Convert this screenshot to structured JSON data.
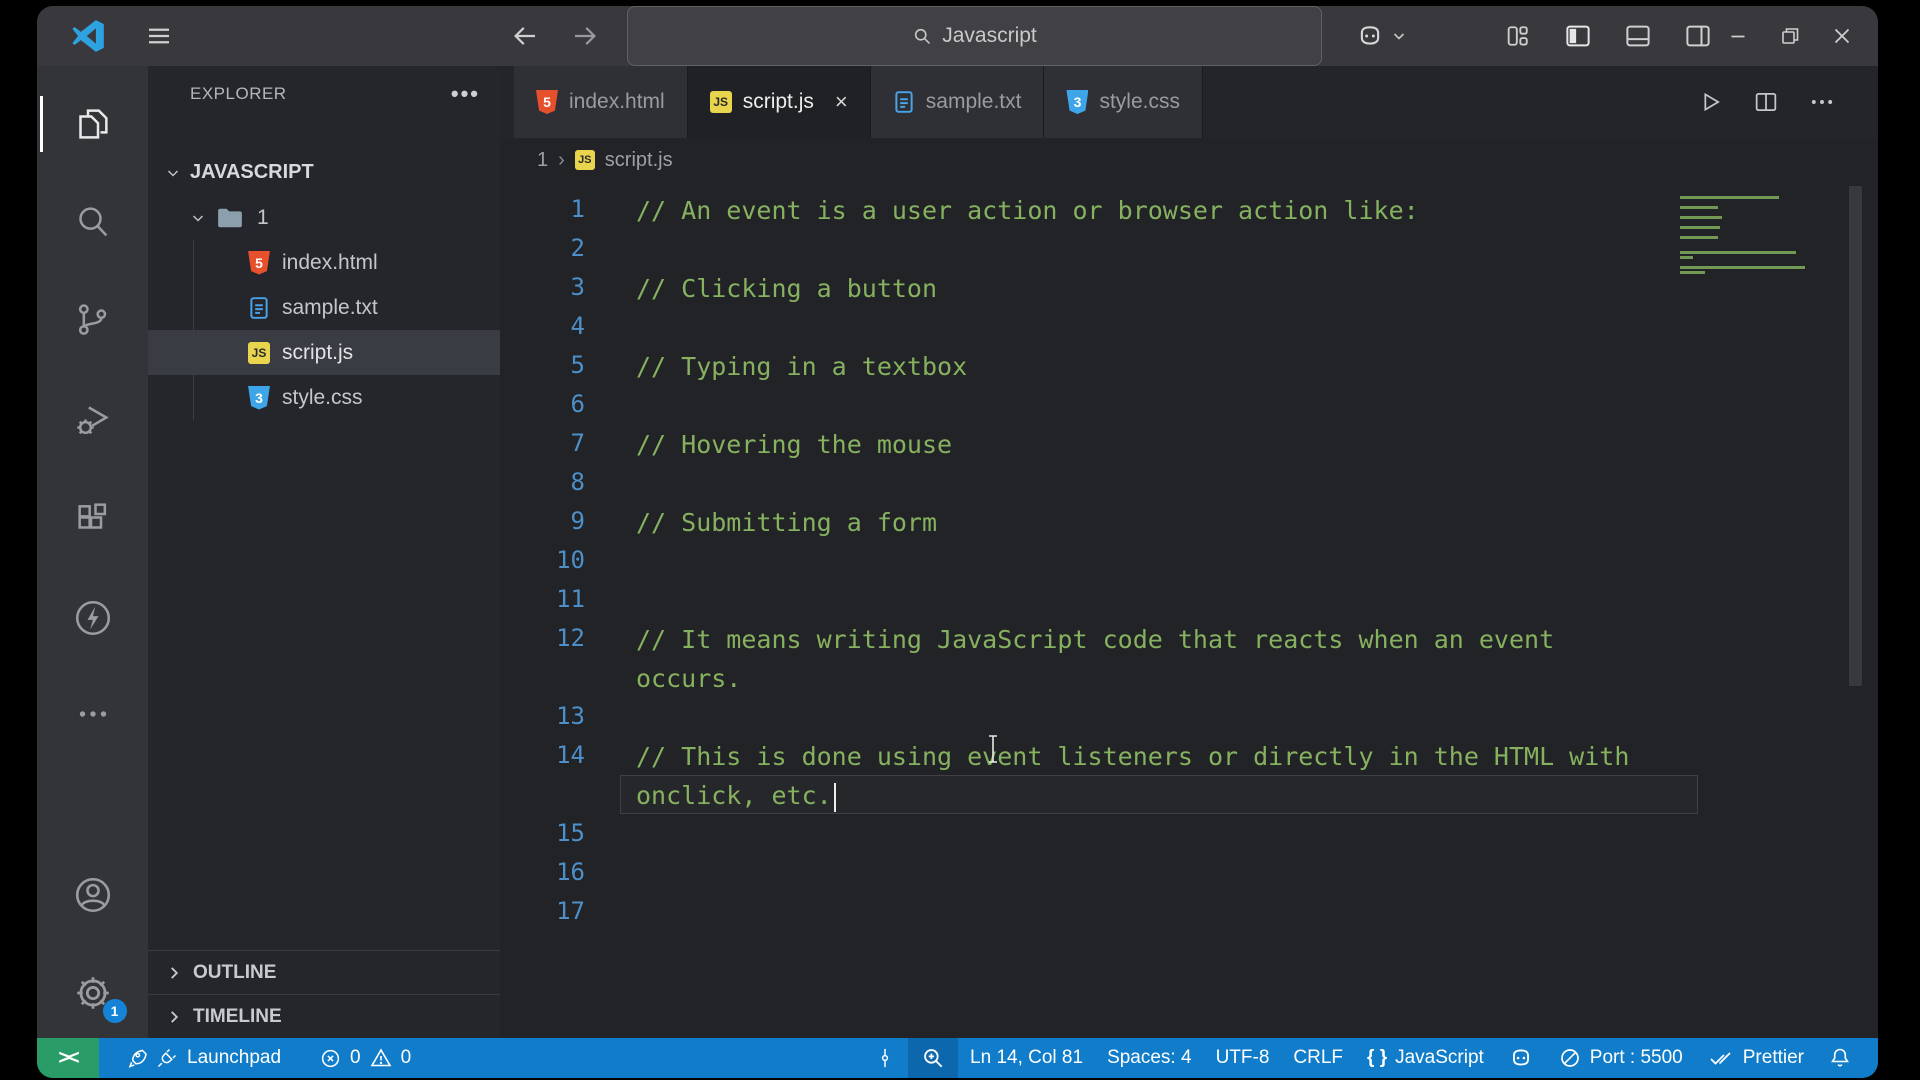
{
  "colors": {
    "statusbar_blue": "#117dca",
    "remote_green": "#2a9c68",
    "comment_green": "#86b15f",
    "line_number_blue": "#4d8fc9",
    "selection_gray": "#3a3c43",
    "badge_blue": "#1584d8",
    "html_icon_orange": "#e6502c",
    "css_icon_blue": "#3ea6e8",
    "js_icon_yellow": "#e8d44d"
  },
  "title_bar": {
    "search_value": "Javascript",
    "icons": [
      "vscode-logo",
      "menu",
      "arrow-left",
      "arrow-right",
      "search",
      "copilot",
      "chevron-down",
      "customize-layout",
      "toggle-sidebar-left",
      "toggle-panel",
      "toggle-sidebar-right",
      "minimize",
      "restore",
      "close"
    ]
  },
  "activity_bar": {
    "items": [
      {
        "name": "explorer",
        "icon": "files-icon",
        "active": true
      },
      {
        "name": "search",
        "icon": "search-icon"
      },
      {
        "name": "source-control",
        "icon": "git-icon"
      },
      {
        "name": "run-debug",
        "icon": "debug-icon"
      },
      {
        "name": "extensions",
        "icon": "extensions-icon"
      },
      {
        "name": "live-server",
        "icon": "lightning-icon"
      },
      {
        "name": "more",
        "icon": "ellipsis-icon"
      }
    ],
    "bottom": [
      {
        "name": "accounts",
        "icon": "account-icon"
      },
      {
        "name": "settings",
        "icon": "gear-icon",
        "badge": "1"
      }
    ]
  },
  "explorer": {
    "title": "EXPLORER",
    "more_label": "•••",
    "workspace": "JAVASCRIPT",
    "folder": "1",
    "files": [
      {
        "name": "index.html",
        "type": "html"
      },
      {
        "name": "sample.txt",
        "type": "txt"
      },
      {
        "name": "script.js",
        "type": "js",
        "selected": true
      },
      {
        "name": "style.css",
        "type": "css"
      }
    ],
    "sections": [
      "OUTLINE",
      "TIMELINE"
    ]
  },
  "tabs": [
    {
      "label": "index.html",
      "type": "html",
      "active": false
    },
    {
      "label": "script.js",
      "type": "js",
      "active": true,
      "close_glyph": "×"
    },
    {
      "label": "sample.txt",
      "type": "txt",
      "active": false
    },
    {
      "label": "style.css",
      "type": "css",
      "active": false
    }
  ],
  "editor_actions": [
    "run-icon",
    "split-editor-icon",
    "more-actions-icon"
  ],
  "breadcrumb": {
    "folder": "1",
    "separator": "›",
    "file": "script.js"
  },
  "editor": {
    "rows": [
      {
        "n": "1",
        "t": "// An event is a user action or browser action like:"
      },
      {
        "n": "2",
        "t": ""
      },
      {
        "n": "3",
        "t": "// Clicking a button"
      },
      {
        "n": "4",
        "t": ""
      },
      {
        "n": "5",
        "t": "// Typing in a textbox"
      },
      {
        "n": "6",
        "t": ""
      },
      {
        "n": "7",
        "t": "// Hovering the mouse"
      },
      {
        "n": "8",
        "t": ""
      },
      {
        "n": "9",
        "t": "// Submitting a form"
      },
      {
        "n": "10",
        "t": ""
      },
      {
        "n": "11",
        "t": ""
      },
      {
        "n": "12",
        "t": "// It means writing JavaScript code that reacts when an event"
      },
      {
        "n": "",
        "t": "occurs."
      },
      {
        "n": "13",
        "t": ""
      },
      {
        "n": "14",
        "t": "// This is done using event listeners or directly in the HTML with"
      },
      {
        "n": "",
        "t": "onclick, etc.",
        "current": true,
        "cursor": true
      },
      {
        "n": "15",
        "t": ""
      },
      {
        "n": "16",
        "t": ""
      },
      {
        "n": "17",
        "t": ""
      }
    ]
  },
  "status_bar": {
    "remote_glyph": "><",
    "launchpad": {
      "label": "Launchpad",
      "icons": [
        "rocket-icon",
        "plug-icon"
      ]
    },
    "problems": {
      "errors": "0",
      "warnings": "0"
    },
    "center_icons": [
      "antenna-icon",
      "zoom-in-icon"
    ],
    "right_items": [
      {
        "icon": "",
        "label": "Ln 14, Col 81",
        "name": "cursor-position"
      },
      {
        "icon": "",
        "label": "Spaces: 4",
        "name": "indentation"
      },
      {
        "icon": "",
        "label": "UTF-8",
        "name": "encoding"
      },
      {
        "icon": "",
        "label": "CRLF",
        "name": "eol"
      },
      {
        "icon": "braces",
        "label": "JavaScript",
        "name": "language-mode"
      },
      {
        "icon": "copilot",
        "label": "",
        "name": "copilot"
      },
      {
        "icon": "circle-slash",
        "label": "Port : 5500",
        "name": "live-server-port"
      },
      {
        "icon": "double-check",
        "label": "Prettier",
        "name": "prettier"
      },
      {
        "icon": "bell",
        "label": "",
        "name": "notifications"
      }
    ]
  }
}
